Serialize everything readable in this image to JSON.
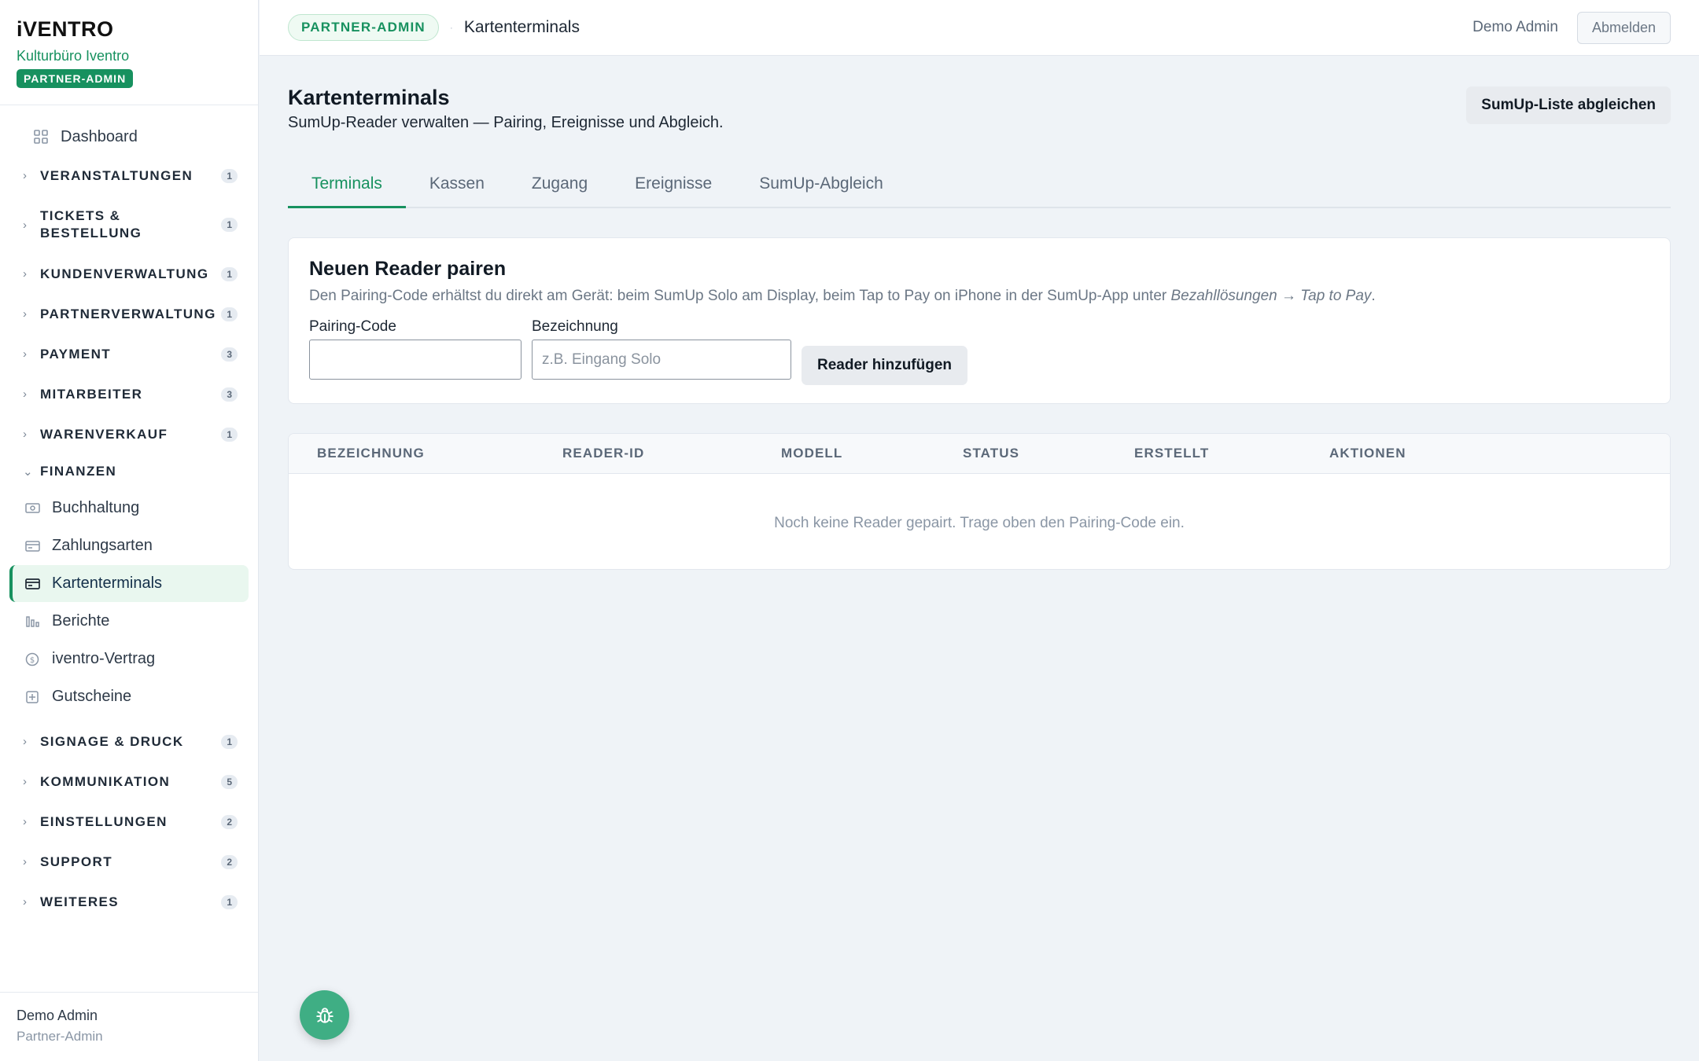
{
  "brand": {
    "logo": "iVENTRO",
    "org": "Kulturbüro Iventro",
    "badge": "PARTNER-ADMIN"
  },
  "sidebar": {
    "dashboard": "Dashboard",
    "groups": [
      {
        "label": "VERANSTALTUNGEN",
        "count": "1"
      },
      {
        "label": "TICKETS & BESTELLUNG",
        "count": "1"
      },
      {
        "label": "KUNDENVERWALTUNG",
        "count": "1"
      },
      {
        "label": "PARTNERVERWALTUNG",
        "count": "1"
      },
      {
        "label": "PAYMENT",
        "count": "3"
      },
      {
        "label": "MITARBEITER",
        "count": "3"
      },
      {
        "label": "WARENVERKAUF",
        "count": "1"
      },
      {
        "label": "FINANZEN",
        "count": ""
      },
      {
        "label": "SIGNAGE & DRUCK",
        "count": "1"
      },
      {
        "label": "KOMMUNIKATION",
        "count": "5"
      },
      {
        "label": "EINSTELLUNGEN",
        "count": "2"
      },
      {
        "label": "SUPPORT",
        "count": "2"
      },
      {
        "label": "WEITERES",
        "count": "1"
      }
    ],
    "finanzen_items": [
      {
        "label": "Buchhaltung",
        "icon": "cash-icon"
      },
      {
        "label": "Zahlungsarten",
        "icon": "card-icon"
      },
      {
        "label": "Kartenterminals",
        "icon": "credit-card-icon",
        "active": true
      },
      {
        "label": "Berichte",
        "icon": "chart-icon"
      },
      {
        "label": "iventro-Vertrag",
        "icon": "dollar-circle-icon"
      },
      {
        "label": "Gutscheine",
        "icon": "gift-icon"
      }
    ],
    "footer": {
      "name": "Demo Admin",
      "role": "Partner-Admin"
    }
  },
  "topbar": {
    "role_pill": "PARTNER-ADMIN",
    "separator": "·",
    "page": "Kartenterminals",
    "user": "Demo Admin",
    "logout": "Abmelden"
  },
  "page": {
    "title": "Kartenterminals",
    "subtitle": "SumUp-Reader verwalten — Pairing, Ereignisse und Abgleich.",
    "sync_button": "SumUp-Liste abgleichen"
  },
  "tabs": [
    "Terminals",
    "Kassen",
    "Zugang",
    "Ereignisse",
    "SumUp-Abgleich"
  ],
  "pairing": {
    "title": "Neuen Reader pairen",
    "desc_prefix": "Den Pairing-Code erhältst du direkt am Gerät: beim SumUp Solo am Display, beim Tap to Pay on iPhone in der SumUp-App unter ",
    "desc_path": "Bezahllösungen → Tap to Pay",
    "desc_suffix": ".",
    "code_label": "Pairing-Code",
    "code_value": "",
    "name_label": "Bezeichnung",
    "name_placeholder": "z.B. Eingang Solo",
    "add_button": "Reader hinzufügen"
  },
  "table": {
    "columns": [
      "BEZEICHNUNG",
      "READER-ID",
      "MODELL",
      "STATUS",
      "ERSTELLT",
      "AKTIONEN"
    ],
    "rows": [],
    "empty": "Noch keine Reader gepairt. Trage oben den Pairing-Code ein."
  },
  "colors": {
    "accent": "#17915f",
    "fab": "#3fae84",
    "background": "#eff3f7"
  }
}
